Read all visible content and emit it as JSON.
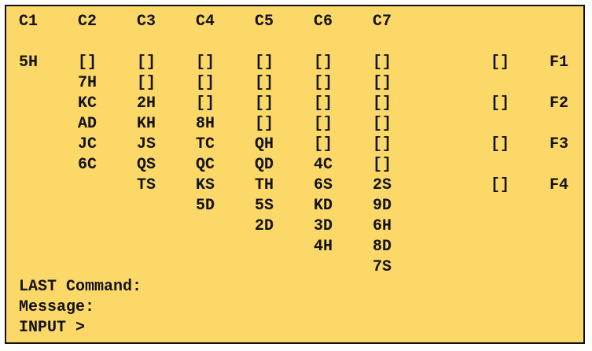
{
  "columns": [
    {
      "header": "C1",
      "cards": [
        "5H"
      ]
    },
    {
      "header": "C2",
      "cards": [
        "[]",
        "7H",
        "KC",
        "AD",
        "JC",
        "6C"
      ]
    },
    {
      "header": "C3",
      "cards": [
        "[]",
        "[]",
        "2H",
        "KH",
        "JS",
        "QS",
        "TS"
      ]
    },
    {
      "header": "C4",
      "cards": [
        "[]",
        "[]",
        "[]",
        "8H",
        "TC",
        "QC",
        "KS",
        "5D"
      ]
    },
    {
      "header": "C5",
      "cards": [
        "[]",
        "[]",
        "[]",
        "[]",
        "QH",
        "QD",
        "TH",
        "5S",
        "2D"
      ]
    },
    {
      "header": "C6",
      "cards": [
        "[]",
        "[]",
        "[]",
        "[]",
        "[]",
        "4C",
        "6S",
        "KD",
        "3D",
        "4H"
      ]
    },
    {
      "header": "C7",
      "cards": [
        "[]",
        "[]",
        "[]",
        "[]",
        "[]",
        "[]",
        "2S",
        "9D",
        "6H",
        "8D",
        "7S"
      ]
    }
  ],
  "foundations": [
    {
      "slot": "[]",
      "label": "F1"
    },
    {
      "slot": "[]",
      "label": "F2"
    },
    {
      "slot": "[]",
      "label": "F3"
    },
    {
      "slot": "[]",
      "label": "F4"
    }
  ],
  "console": {
    "last_command_label": "LAST Command:",
    "last_command_value": "",
    "message_label": "Message:",
    "message_value": "",
    "input_prompt": "INPUT >",
    "input_value": ""
  },
  "colors": {
    "board_background": "#fcd869",
    "text": "#111111",
    "border": "#111111"
  }
}
